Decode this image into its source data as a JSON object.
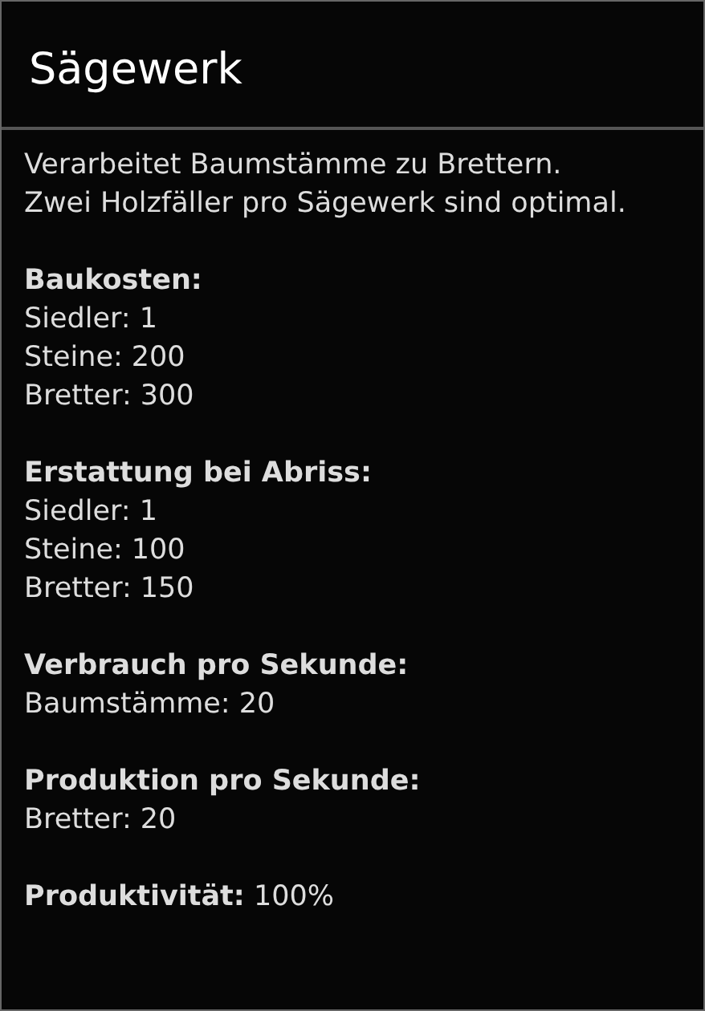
{
  "dialog": {
    "title": "Sägewerk",
    "description": "Verarbeitet Baumstämme zu Brettern. Zwei Holzfäller pro Sägewerk sind optimal.",
    "sections": [
      {
        "heading": "Baukosten:",
        "lines": [
          "Siedler: 1",
          "Steine: 200",
          "Bretter: 300"
        ]
      },
      {
        "heading": "Erstattung bei Abriss:",
        "lines": [
          "Siedler: 1",
          "Steine: 100",
          "Bretter: 150"
        ]
      },
      {
        "heading": "Verbrauch pro Sekunde:",
        "lines": [
          "Baumstämme: 20"
        ]
      },
      {
        "heading": "Produktion pro Sekunde:",
        "lines": [
          "Bretter: 20"
        ]
      }
    ],
    "footer": "**Produktivität:** 100%"
  }
}
